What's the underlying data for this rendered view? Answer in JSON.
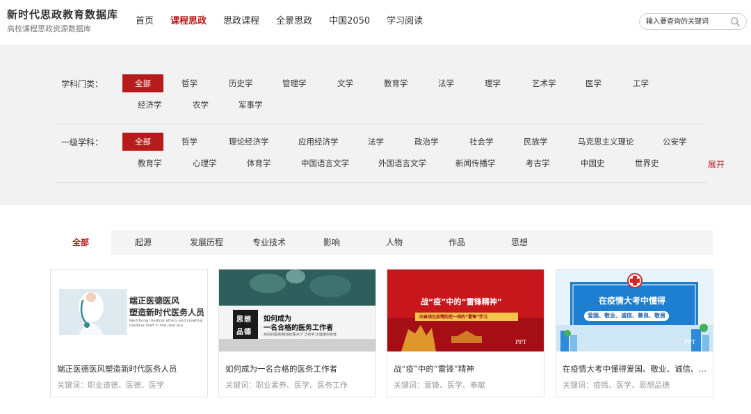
{
  "header": {
    "logo_title": "新时代思政教育数据库",
    "logo_subtitle": "高校课程思政资源数据库",
    "nav": [
      {
        "label": "首页",
        "active": false
      },
      {
        "label": "课程思政",
        "active": true
      },
      {
        "label": "思政课程",
        "active": false
      },
      {
        "label": "全景思政",
        "active": false
      },
      {
        "label": "中国2050",
        "active": false
      },
      {
        "label": "学习阅读",
        "active": false
      }
    ],
    "search_placeholder": "输入要查询的关键词"
  },
  "filters": {
    "category_label": "学科门类：",
    "categories": [
      "全部",
      "哲学",
      "历史学",
      "管理学",
      "文学",
      "教育学",
      "法学",
      "理学",
      "艺术学",
      "医学",
      "工学",
      "经济学",
      "农学",
      "军事学"
    ],
    "subject_label": "一级学科：",
    "subjects": [
      "全部",
      "哲学",
      "理论经济学",
      "应用经济学",
      "法学",
      "政治学",
      "社会学",
      "民族学",
      "马克思主义理论",
      "公安学",
      "教育学",
      "心理学",
      "体育学",
      "中国语言文学",
      "外国语言文学",
      "新闻传播学",
      "考古学",
      "中国史",
      "世界史"
    ],
    "expand_label": "展开"
  },
  "tabs": [
    "全部",
    "起源",
    "发展历程",
    "专业技术",
    "影响",
    "人物",
    "作品",
    "思想"
  ],
  "cards": [
    {
      "title": "端正医德医风塑造新时代医务人员",
      "keywords": "关键词：职业道德、医德、医学",
      "thumb_line1": "端正医德医风",
      "thumb_line2": "塑造新时代医务人员",
      "thumb_small": "Rectifying medical ethics and creating medical staff in the new era"
    },
    {
      "title": "如何成为一名合格的医务工作者",
      "keywords": "关键词：职业素养、医学、医务工作",
      "thumb_badge1": "思想",
      "thumb_badge2": "品德",
      "thumb_line1": "如何成为",
      "thumb_line2": "一名合格的医务工作者",
      "thumb_small": "高尚的医德/精湛的医术/广泛的学习/健康的身体"
    },
    {
      "title": "战“疫”中的“雷锋”精神",
      "keywords": "关键词：雷锋、医学、奉献",
      "thumb_line1": "战“疫”中的“雷锋精神”",
      "thumb_line2": "向奋战在疫情防控一线的“雷锋”学习",
      "thumb_tag": "PPT"
    },
    {
      "title": "在疫情大考中懂得爱国、敬业、诚信、友善",
      "keywords": "关键词：疫情、医学、思想品德",
      "thumb_line1": "在疫情大考中懂得",
      "thumb_line2": "爱国、敬业、诚信、善良、敬畏",
      "thumb_tag": "PPT"
    }
  ],
  "colors": {
    "accent": "#b71c1c",
    "filter_bg": "#f2f2f3",
    "tab_bg": "#f4f4f5"
  }
}
